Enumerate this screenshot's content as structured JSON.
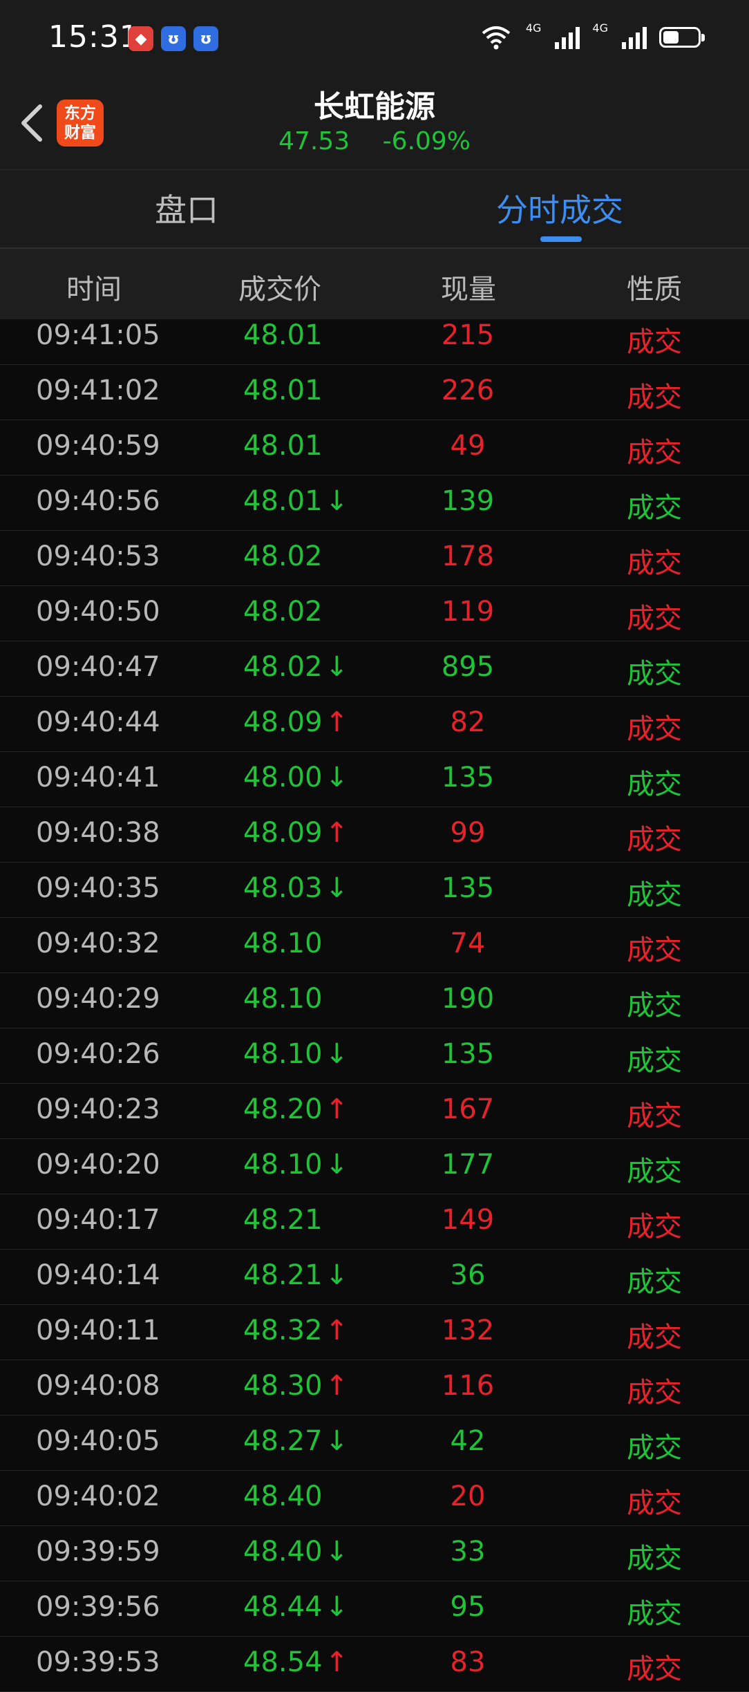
{
  "status": {
    "time": "15:31",
    "signal_label_1": "4G",
    "signal_label_2": "4G",
    "wifi_label": "6"
  },
  "header": {
    "title": "长虹能源",
    "price": "47.53",
    "change": "-6.09%",
    "logo_text_1": "东方",
    "logo_text_2": "财富"
  },
  "tabs": [
    {
      "label": "盘口"
    },
    {
      "label": "分时成交"
    }
  ],
  "columns": [
    "时间",
    "成交价",
    "现量",
    "性质"
  ],
  "colors": {
    "up": "#e8222a",
    "down": "#1ec337",
    "accent": "#3d8ef0"
  },
  "trades": [
    {
      "time": "09:41:05",
      "price": "48.01",
      "arrow": "",
      "vol": "215",
      "dir": "up",
      "type": "成交"
    },
    {
      "time": "09:41:02",
      "price": "48.01",
      "arrow": "",
      "vol": "226",
      "dir": "up",
      "type": "成交"
    },
    {
      "time": "09:40:59",
      "price": "48.01",
      "arrow": "",
      "vol": "49",
      "dir": "up",
      "type": "成交"
    },
    {
      "time": "09:40:56",
      "price": "48.01",
      "arrow": "down",
      "vol": "139",
      "dir": "down",
      "type": "成交"
    },
    {
      "time": "09:40:53",
      "price": "48.02",
      "arrow": "",
      "vol": "178",
      "dir": "up",
      "type": "成交"
    },
    {
      "time": "09:40:50",
      "price": "48.02",
      "arrow": "",
      "vol": "119",
      "dir": "up",
      "type": "成交"
    },
    {
      "time": "09:40:47",
      "price": "48.02",
      "arrow": "down",
      "vol": "895",
      "dir": "down",
      "type": "成交"
    },
    {
      "time": "09:40:44",
      "price": "48.09",
      "arrow": "up",
      "vol": "82",
      "dir": "up",
      "type": "成交"
    },
    {
      "time": "09:40:41",
      "price": "48.00",
      "arrow": "down",
      "vol": "135",
      "dir": "down",
      "type": "成交"
    },
    {
      "time": "09:40:38",
      "price": "48.09",
      "arrow": "up",
      "vol": "99",
      "dir": "up",
      "type": "成交"
    },
    {
      "time": "09:40:35",
      "price": "48.03",
      "arrow": "down",
      "vol": "135",
      "dir": "down",
      "type": "成交"
    },
    {
      "time": "09:40:32",
      "price": "48.10",
      "arrow": "",
      "vol": "74",
      "dir": "up",
      "type": "成交"
    },
    {
      "time": "09:40:29",
      "price": "48.10",
      "arrow": "",
      "vol": "190",
      "dir": "down",
      "type": "成交"
    },
    {
      "time": "09:40:26",
      "price": "48.10",
      "arrow": "down",
      "vol": "135",
      "dir": "down",
      "type": "成交"
    },
    {
      "time": "09:40:23",
      "price": "48.20",
      "arrow": "up",
      "vol": "167",
      "dir": "up",
      "type": "成交"
    },
    {
      "time": "09:40:20",
      "price": "48.10",
      "arrow": "down",
      "vol": "177",
      "dir": "down",
      "type": "成交"
    },
    {
      "time": "09:40:17",
      "price": "48.21",
      "arrow": "",
      "vol": "149",
      "dir": "up",
      "type": "成交"
    },
    {
      "time": "09:40:14",
      "price": "48.21",
      "arrow": "down",
      "vol": "36",
      "dir": "down",
      "type": "成交"
    },
    {
      "time": "09:40:11",
      "price": "48.32",
      "arrow": "up",
      "vol": "132",
      "dir": "up",
      "type": "成交"
    },
    {
      "time": "09:40:08",
      "price": "48.30",
      "arrow": "up",
      "vol": "116",
      "dir": "up",
      "type": "成交"
    },
    {
      "time": "09:40:05",
      "price": "48.27",
      "arrow": "down",
      "vol": "42",
      "dir": "down",
      "type": "成交"
    },
    {
      "time": "09:40:02",
      "price": "48.40",
      "arrow": "",
      "vol": "20",
      "dir": "up",
      "type": "成交"
    },
    {
      "time": "09:39:59",
      "price": "48.40",
      "arrow": "down",
      "vol": "33",
      "dir": "down",
      "type": "成交"
    },
    {
      "time": "09:39:56",
      "price": "48.44",
      "arrow": "down",
      "vol": "95",
      "dir": "down",
      "type": "成交"
    },
    {
      "time": "09:39:53",
      "price": "48.54",
      "arrow": "up",
      "vol": "83",
      "dir": "up",
      "type": "成交"
    }
  ]
}
